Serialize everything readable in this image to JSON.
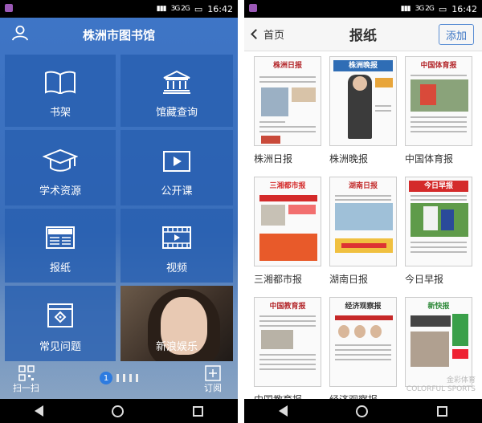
{
  "statusbar": {
    "time": "16:42",
    "network": "3G 2G"
  },
  "library": {
    "title": "株洲市图书馆",
    "tiles": [
      {
        "label": "书架",
        "icon": "book-icon"
      },
      {
        "label": "馆藏查询",
        "icon": "library-building-icon"
      },
      {
        "label": "学术资源",
        "icon": "graduation-cap-icon"
      },
      {
        "label": "公开课",
        "icon": "video-play-icon"
      },
      {
        "label": "报纸",
        "icon": "newspaper-icon"
      },
      {
        "label": "视频",
        "icon": "film-icon"
      },
      {
        "label": "常见问题",
        "icon": "faq-icon"
      },
      {
        "label": "新浪娱乐",
        "icon": "photo"
      }
    ],
    "bottom": {
      "scan_label": "扫一扫",
      "subscribe_label": "订阅",
      "page_current": "1"
    }
  },
  "newspapers_page": {
    "back_label": "首页",
    "title": "报纸",
    "add_label": "添加",
    "papers": [
      {
        "name": "株洲日报",
        "masthead": "株洲日报",
        "accent": "#b3262a"
      },
      {
        "name": "株洲晚报",
        "masthead": "株洲晚报",
        "accent": "#2f6db5"
      },
      {
        "name": "中国体育报",
        "masthead": "中国体育报",
        "accent": "#b3262a"
      },
      {
        "name": "三湘都市报",
        "masthead": "三湘都市报",
        "accent": "#d42a2a"
      },
      {
        "name": "湖南日报",
        "masthead": "湖南日报",
        "accent": "#c22a2a"
      },
      {
        "name": "今日早报",
        "masthead": "今日早报",
        "accent": "#d42a2a"
      },
      {
        "name": "中国教育报",
        "masthead": "中国教育报",
        "accent": "#b3262a"
      },
      {
        "name": "经济观察报",
        "masthead": "经济观察报",
        "accent": "#333333"
      },
      {
        "name": "",
        "masthead": "新快报",
        "accent": "#2f8a3a"
      }
    ]
  },
  "watermark": {
    "line1": "金彩体育",
    "line2": "COLORFUL SPORTS"
  }
}
